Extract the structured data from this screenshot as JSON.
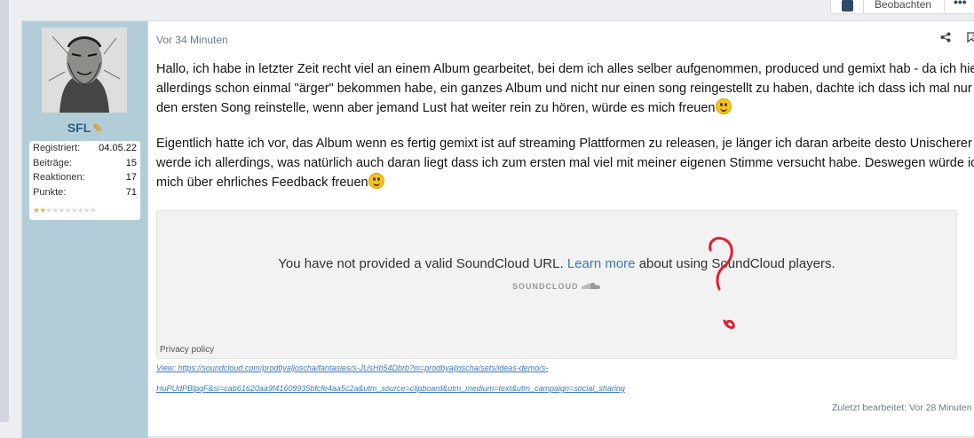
{
  "toolbar": {
    "watch_label": "Beobachten",
    "more_label": "•••"
  },
  "user": {
    "name": "SFL",
    "stats": [
      {
        "label": "Registriert:",
        "value": "04.05.22"
      },
      {
        "label": "Beiträge:",
        "value": "15"
      },
      {
        "label": "Reaktionen:",
        "value": "17"
      },
      {
        "label": "Punkte:",
        "value": "71"
      }
    ],
    "rating_stars": 2,
    "rating_max": 10
  },
  "post": {
    "time": "Vor 34 Minuten",
    "number": "#",
    "paragraph1": "Hallo, ich habe in letzter Zeit recht viel an einem Album gearbeitet, bei dem ich alles selber aufgenommen, produced und gemixt hab - da ich hier allerdings schon einmal \"ärger\" bekommen habe, ein ganzes Album und nicht nur einen song reingestellt zu haben, dachte ich dass ich mal nur den ersten Song reinstelle, wenn aber jemand Lust hat weiter rein zu hören, würde es mich freuen",
    "paragraph2": "Eigentlich hatte ich vor, das Album wenn es fertig gemixt ist auf streaming Plattformen zu releasen, je länger ich daran arbeite desto Unischerer werde ich allerdings, was natürlich auch daran liegt dass ich zum ersten mal viel mit meiner eigenen Stimme versucht habe. Deswegen würde ich mich über ehrliches Feedback freuen",
    "embed": {
      "msg_before": "You have not provided a valid SoundCloud URL.",
      "link": "Learn more",
      "msg_after": "about using SoundCloud players.",
      "brand": "SOUNDCLOUD",
      "privacy": "Privacy policy"
    },
    "view_link_1": "View: https://soundcloud.com/prodbyaljoscha/fantasies/s-JUsHb54Dbrb?in=prodbyaljoscha/sets/ideas-demo/s-",
    "view_link_2": "HuPUdPBlpqF&si=cab61620aa9f41609935bfcfe4aa5c2a&utm_source=clipboard&utm_medium=text&utm_campaign=social_sharing",
    "edited": "Zuletzt bearbeitet: Vor 28 Minuten"
  },
  "colors": {
    "user_panel": "#b3cdd8",
    "username": "#2c5f7e",
    "link": "#3c78c3",
    "annotation": "#e0202c"
  }
}
